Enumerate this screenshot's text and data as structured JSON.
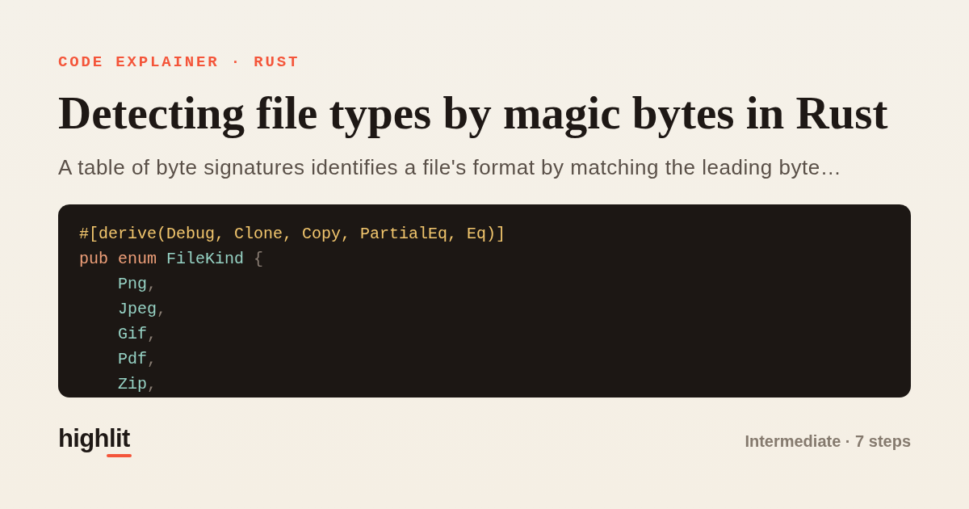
{
  "eyebrow": "CODE EXPLAINER · RUST",
  "title": "Detecting file types by magic bytes in Rust",
  "subtitle": "A table of byte signatures identifies a file's format by matching the leading byte…",
  "code": {
    "lines": [
      {
        "tokens": [
          {
            "kind": "attr",
            "text": "#[derive(Debug, Clone, Copy, PartialEq, Eq)]"
          }
        ]
      },
      {
        "tokens": [
          {
            "kind": "keyword",
            "text": "pub enum "
          },
          {
            "kind": "type",
            "text": "FileKind "
          },
          {
            "kind": "punct",
            "text": "{"
          }
        ],
        "children": [
          {
            "tokens": [
              {
                "kind": "type",
                "text": "Png"
              },
              {
                "kind": "punct",
                "text": ","
              }
            ]
          },
          {
            "tokens": [
              {
                "kind": "type",
                "text": "Jpeg"
              },
              {
                "kind": "punct",
                "text": ","
              }
            ]
          },
          {
            "tokens": [
              {
                "kind": "type",
                "text": "Gif"
              },
              {
                "kind": "punct",
                "text": ","
              }
            ]
          },
          {
            "tokens": [
              {
                "kind": "type",
                "text": "Pdf"
              },
              {
                "kind": "punct",
                "text": ","
              }
            ]
          },
          {
            "tokens": [
              {
                "kind": "type",
                "text": "Zip"
              },
              {
                "kind": "punct",
                "text": ","
              }
            ]
          }
        ]
      }
    ]
  },
  "footer": {
    "logo": "highlit",
    "meta": "Intermediate · 7 steps"
  }
}
